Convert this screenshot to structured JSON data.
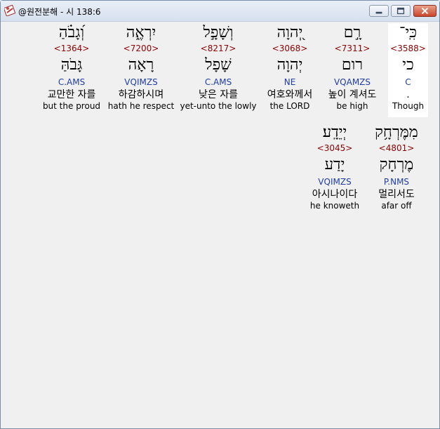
{
  "window": {
    "title": "@원전분해 - 시 138:6",
    "controls": {
      "minimize": "minimize",
      "maximize": "maximize",
      "close": "close"
    }
  },
  "line1": [
    {
      "hebrew": "כִּֽי־",
      "strongs": "<3588>",
      "lemma": "כי",
      "morph": "C",
      "korean": ".",
      "english": "Though"
    },
    {
      "hebrew": "רָ֣ם",
      "strongs": "<7311>",
      "lemma": "רום",
      "morph": "VQAMZS",
      "korean": "높이 계셔도",
      "english": "be high"
    },
    {
      "hebrew": "יְ֭הוָה",
      "strongs": "<3068>",
      "lemma": "יְהוָה",
      "morph": "NE",
      "korean": "여호와께서",
      "english": "the LORD"
    },
    {
      "hebrew": "וְשָׁפָ֣ל",
      "strongs": "<8217>",
      "lemma": "שָׁפָל",
      "morph": "C.AMS",
      "korean": "낮은 자를",
      "english": "yet-unto the lowly"
    },
    {
      "hebrew": "יִרְאֶ֑ה",
      "strongs": "<7200>",
      "lemma": "רָאָה",
      "morph": "VQIMZS",
      "korean": "하감하시며",
      "english": "hath he respect"
    },
    {
      "hebrew": "וְ֝גָבֹ֗הַ",
      "strongs": "<1364>",
      "lemma": "גָּבֹהַּ",
      "morph": "C.AMS",
      "korean": "교만한 자를",
      "english": "but the proud"
    }
  ],
  "line2": [
    {
      "hebrew": "מִמֶּרְחָ֥ק",
      "strongs": "<4801>",
      "lemma": "מֶרְחָק",
      "morph": "P.NMS",
      "korean": "멀리서도",
      "english": "afar off"
    },
    {
      "hebrew": "יְיֵדָֽע׃",
      "strongs": "<3045>",
      "lemma": "יָדַע",
      "morph": "VQIMZS",
      "korean": "아시나이다",
      "english": "he knoweth"
    }
  ]
}
